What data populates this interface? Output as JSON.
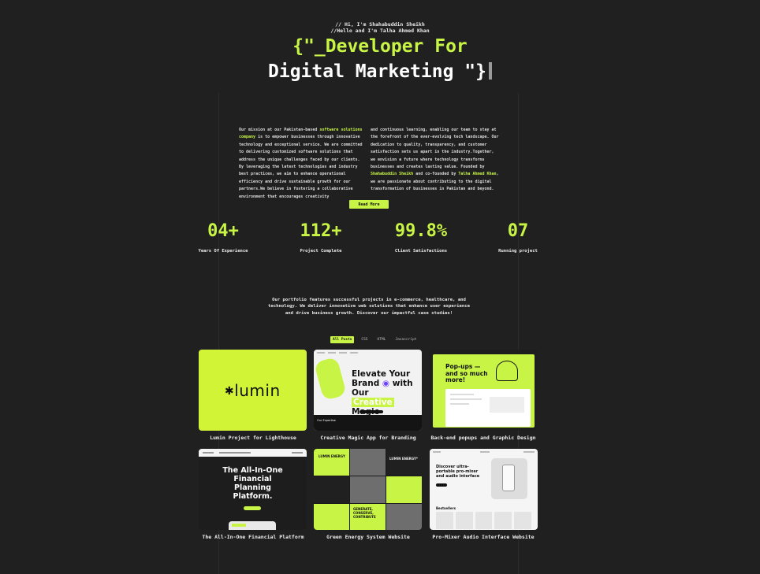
{
  "hero": {
    "hi_line_1": "// Hi, I'm Shahabuddin Sheikh",
    "hi_line_2": "//Hello and I'm Talha Ahmed Khan",
    "title_line_1": "{\"_Developer For",
    "title_line_2": "Digital Marketing \"}"
  },
  "about": {
    "col1": {
      "before": "Our mission at our Pakistan-based ",
      "link": "software solutions company",
      "after": " is to empower businesses through innovative technology and exceptional service. We are committed to delivering customized software solutions that address the unique challenges faced by our clients. By leveraging the latest technologies and industry best practices, we aim to enhance operational efficiency and drive sustainable growth for our partners.We believe in fostering a collaborative environment that encourages creativity"
    },
    "col2": {
      "text": "and continuous learning, enabling our team to stay at the forefront of the ever-evolving tech landscape. Our dedication to quality, transparency, and customer satisfaction sets us apart in the industry.Together, we envision a future where technology transforms businesses and creates lasting value. Founded by ",
      "founder_1": "Shahabuddin Sheikh",
      "middle": " and co-founded by ",
      "founder_2": "Talha Ahmed Khan",
      "after": ", we are passionate about contributing to the digital transformation of businesses in Pakistan and beyond."
    },
    "read_more_label": "Read More"
  },
  "stats": [
    {
      "value": "04+",
      "label": "Years Of Experience"
    },
    {
      "value": "112+",
      "label": "Project Complete"
    },
    {
      "value": "99.8%",
      "label": "Client Satisfactions"
    },
    {
      "value": "07",
      "label": "Running project"
    }
  ],
  "portfolio": {
    "intro": "Our portfolio features successful projects in e-commerce, healthcare, and technology. We deliver innovative web solutions that enhance user experience and drive business growth. Discover our impactful case studies!",
    "filters": [
      "All Posts",
      "CSS",
      "HTML",
      "Javascript"
    ],
    "active_filter": "All Posts",
    "projects": [
      {
        "caption": "Lumin Project for Lighthouse",
        "thumb_text": "lumin"
      },
      {
        "caption": "Creative Magic App for Branding",
        "thumb_text_a": "Elevate Your",
        "thumb_text_b": "Brand",
        "thumb_text_c": "with Our",
        "thumb_text_d": "Creative",
        "thumb_text_e": "Magic",
        "thumb_footer": "Our Expertise"
      },
      {
        "caption": "Back-end popups and Graphic Design",
        "thumb_text": "Pop-ups — and so much more!"
      },
      {
        "caption": "The All-In-One Financial Platform",
        "thumb_text": "The All-In-One Financial Planning Platform."
      },
      {
        "caption": "Green Energy System Website",
        "thumb_text_a": "LUMIN ENERGY",
        "thumb_text_b": "GENERATE, CONSERVE, CONTRIBUTE",
        "thumb_text_c": "LUMIN ENERGY*"
      },
      {
        "caption": "Pro-Mixer Audio Interface Website",
        "thumb_text": "Discover ultra-portable pro-mixer and audio interface",
        "thumb_sub": "Bestsellers"
      }
    ]
  },
  "colors": {
    "background": "#202020",
    "accent": "#c8f545"
  }
}
